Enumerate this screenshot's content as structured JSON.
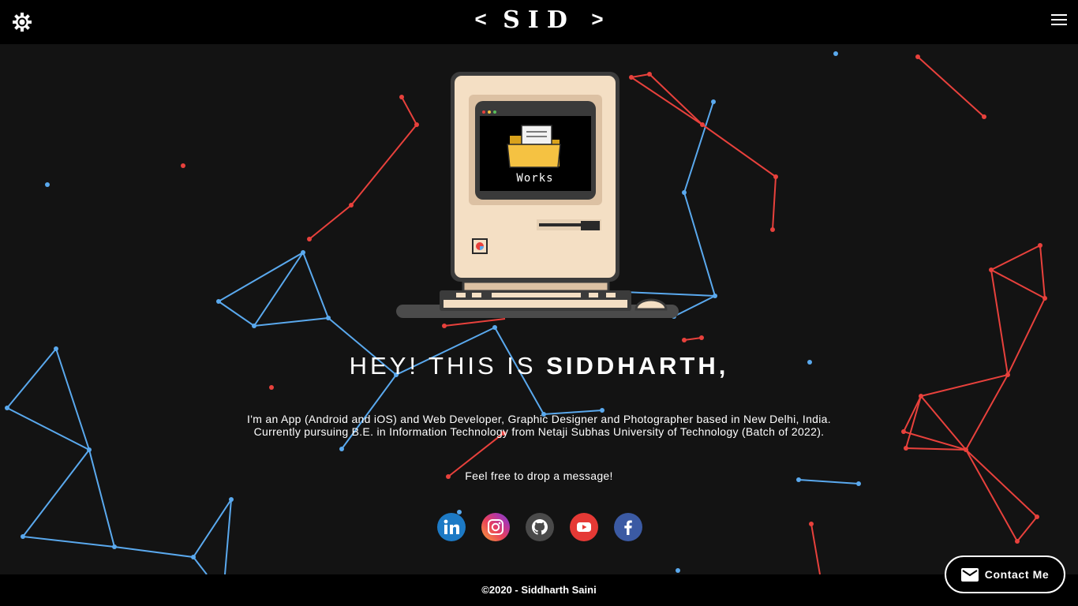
{
  "header": {
    "logo_left": "<",
    "logo_text": "SID",
    "logo_right": ">",
    "theme_icon": "theme-toggle-icon",
    "menu_icon": "hamburger-menu-icon"
  },
  "computer": {
    "screen_label": "Works",
    "folder_icon": "folder-icon"
  },
  "hero": {
    "greeting": "HEY! THIS IS",
    "name": "SIDDHARTH,",
    "about_line1": "I'm an App (Android and iOS) and Web Developer, Graphic Designer and Photographer based in New Delhi, India.",
    "about_line2": "Currently pursuing B.E. in Information Technology from Netaji Subhas University of Technology (Batch of 2022).",
    "cta": "Feel free to drop a message!"
  },
  "socials": [
    {
      "name": "LinkedIn",
      "icon": "linkedin-icon",
      "color": "#1d7ac5"
    },
    {
      "name": "Instagram",
      "icon": "instagram-icon",
      "color": "#e9415b"
    },
    {
      "name": "GitHub",
      "icon": "github-icon",
      "color": "#4a4a4a"
    },
    {
      "name": "YouTube",
      "icon": "youtube-icon",
      "color": "#e53935"
    },
    {
      "name": "Facebook",
      "icon": "facebook-icon",
      "color": "#3b5aa3"
    }
  ],
  "footer": {
    "copyright": "©2020 - Siddharth Saini"
  },
  "contact_button": {
    "label": "Contact Me",
    "icon": "mail-icon"
  },
  "colors": {
    "background": "#131313",
    "bar": "#000000",
    "network_blue": "#5aa9ee",
    "network_red": "#e8413c",
    "computer_body": "#f4dfc4"
  }
}
